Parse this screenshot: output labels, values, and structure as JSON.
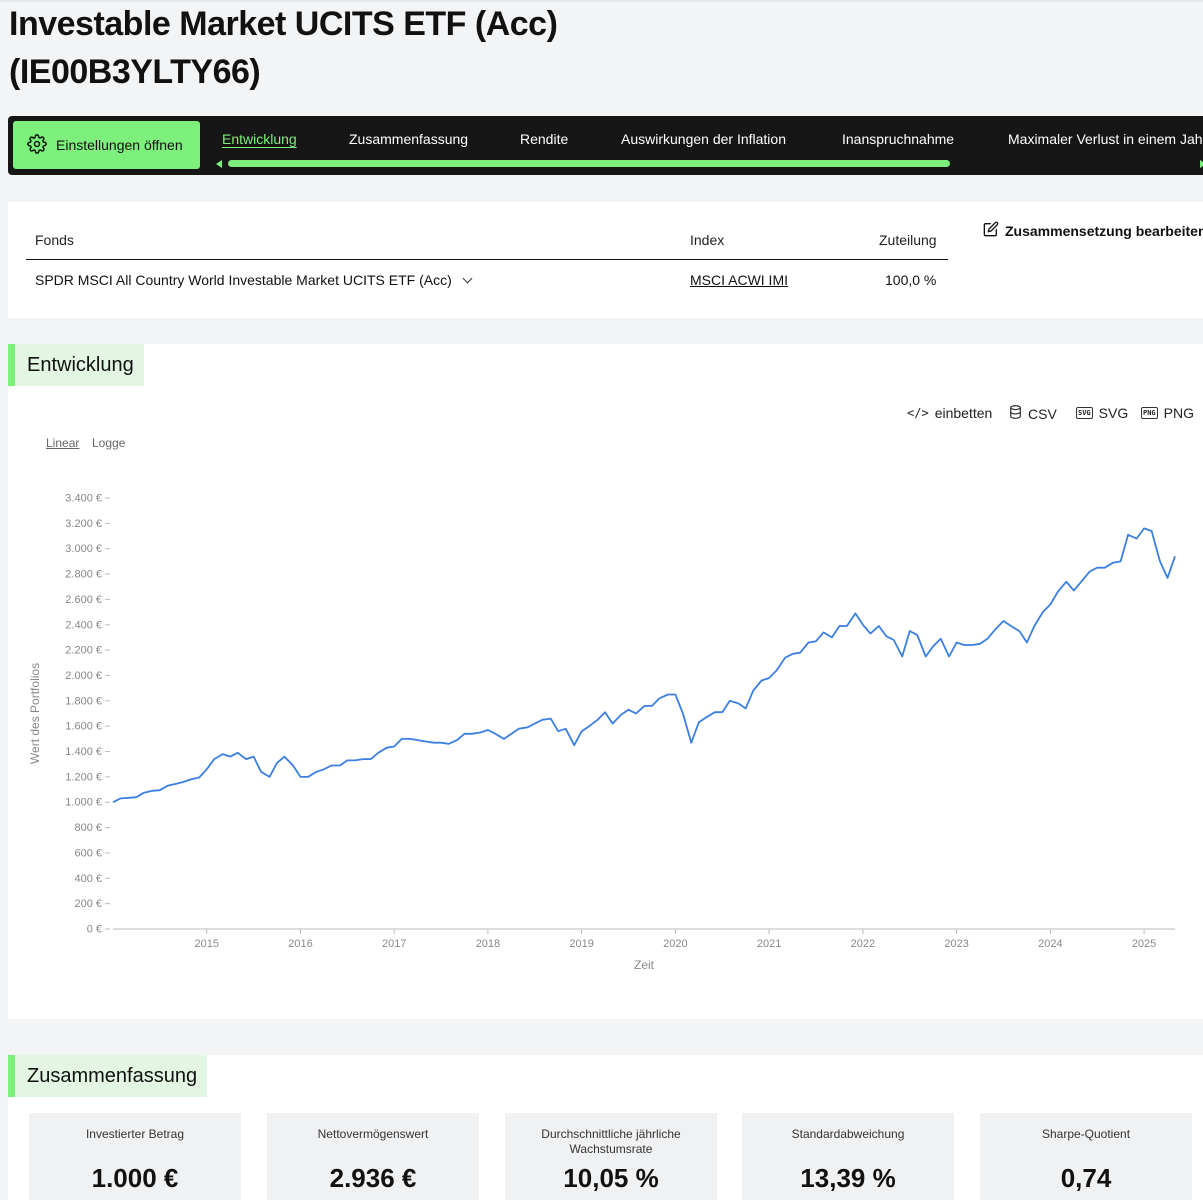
{
  "page": {
    "title_line1": "Investable Market UCITS ETF (Acc)",
    "title_line2": "(IE00B3YLTY66)"
  },
  "nav": {
    "settings_label": "Einstellungen öffnen",
    "tabs": [
      "Entwicklung",
      "Zusammenfassung",
      "Rendite",
      "Auswirkungen der Inflation",
      "Inanspruchnahme",
      "Maximaler Verlust in einem Jahr"
    ],
    "active_tab": "Entwicklung"
  },
  "fund_table": {
    "headers": {
      "fund": "Fonds",
      "index": "Index",
      "allocation": "Zuteilung"
    },
    "rows": [
      {
        "fund": "SPDR MSCI All Country World Investable Market UCITS ETF (Acc)",
        "index": "MSCI ACWI IMI",
        "allocation": "100,0 %"
      }
    ],
    "edit_label": "Zusammensetzung bearbeiten"
  },
  "development": {
    "heading": "Entwicklung",
    "exports": {
      "embed": "einbetten",
      "csv": "CSV",
      "svg": "SVG",
      "png": "PNG"
    },
    "scale_options": {
      "linear": "Linear",
      "log": "Logge"
    },
    "selected_scale": "Linear"
  },
  "chart_data": {
    "type": "line",
    "title": "",
    "xlabel": "Zeit",
    "ylabel": "Wert des Portfolios",
    "y_ticks": [
      "0 €",
      "200 €",
      "400 €",
      "600 €",
      "800 €",
      "1.000 €",
      "1.200 €",
      "1.400 €",
      "1.600 €",
      "1.800 €",
      "2.000 €",
      "2.200 €",
      "2.400 €",
      "2.600 €",
      "2.800 €",
      "3.000 €",
      "3.200 €",
      "3.400 €"
    ],
    "ylim": [
      0,
      3400
    ],
    "x_ticks": [
      "2015",
      "2016",
      "2017",
      "2018",
      "2019",
      "2020",
      "2021",
      "2022",
      "2023",
      "2024",
      "2025"
    ],
    "xlim": [
      2014.0,
      2025.33
    ],
    "grid": false,
    "color": "#3b7fe0",
    "series": [
      {
        "x": [
          2014.0,
          2014.08,
          2014.17,
          2014.25,
          2014.33,
          2014.42,
          2014.5,
          2014.58,
          2014.67,
          2014.75,
          2014.83,
          2014.92,
          2015.0,
          2015.08,
          2015.17,
          2015.25,
          2015.33,
          2015.42,
          2015.5,
          2015.58,
          2015.67,
          2015.75,
          2015.83,
          2015.92,
          2016.0,
          2016.08,
          2016.17,
          2016.25,
          2016.33,
          2016.42,
          2016.5,
          2016.58,
          2016.67,
          2016.75,
          2016.83,
          2016.92,
          2017.0,
          2017.08,
          2017.17,
          2017.25,
          2017.33,
          2017.42,
          2017.5,
          2017.58,
          2017.67,
          2017.75,
          2017.83,
          2017.92,
          2018.0,
          2018.08,
          2018.17,
          2018.25,
          2018.33,
          2018.42,
          2018.5,
          2018.58,
          2018.67,
          2018.75,
          2018.83,
          2018.92,
          2019.0,
          2019.08,
          2019.17,
          2019.25,
          2019.33,
          2019.42,
          2019.5,
          2019.58,
          2019.67,
          2019.75,
          2019.83,
          2019.92,
          2020.0,
          2020.08,
          2020.17,
          2020.25,
          2020.33,
          2020.42,
          2020.5,
          2020.58,
          2020.67,
          2020.75,
          2020.83,
          2020.92,
          2021.0,
          2021.08,
          2021.17,
          2021.25,
          2021.33,
          2021.42,
          2021.5,
          2021.58,
          2021.67,
          2021.75,
          2021.83,
          2021.92,
          2022.0,
          2022.08,
          2022.17,
          2022.25,
          2022.33,
          2022.42,
          2022.5,
          2022.58,
          2022.67,
          2022.75,
          2022.83,
          2022.92,
          2023.0,
          2023.08,
          2023.17,
          2023.25,
          2023.33,
          2023.42,
          2023.5,
          2023.58,
          2023.67,
          2023.75,
          2023.83,
          2023.92,
          2024.0,
          2024.08,
          2024.17,
          2024.25,
          2024.33,
          2024.42,
          2024.5,
          2024.58,
          2024.67,
          2024.75,
          2024.83,
          2024.92,
          2025.0,
          2025.08,
          2025.17,
          2025.25,
          2025.33
        ],
        "values": [
          1000,
          1030,
          1035,
          1040,
          1075,
          1090,
          1095,
          1130,
          1145,
          1160,
          1180,
          1195,
          1260,
          1340,
          1380,
          1360,
          1390,
          1340,
          1360,
          1240,
          1200,
          1310,
          1360,
          1290,
          1200,
          1200,
          1240,
          1260,
          1290,
          1290,
          1330,
          1330,
          1340,
          1340,
          1390,
          1430,
          1440,
          1500,
          1500,
          1490,
          1480,
          1470,
          1470,
          1460,
          1490,
          1540,
          1540,
          1550,
          1570,
          1540,
          1500,
          1540,
          1580,
          1590,
          1620,
          1650,
          1660,
          1560,
          1580,
          1450,
          1560,
          1600,
          1650,
          1710,
          1620,
          1690,
          1730,
          1700,
          1760,
          1760,
          1820,
          1850,
          1850,
          1700,
          1470,
          1630,
          1670,
          1710,
          1710,
          1800,
          1780,
          1740,
          1880,
          1960,
          1980,
          2040,
          2140,
          2170,
          2180,
          2260,
          2270,
          2340,
          2300,
          2390,
          2390,
          2490,
          2400,
          2330,
          2390,
          2310,
          2280,
          2150,
          2350,
          2320,
          2150,
          2230,
          2290,
          2150,
          2260,
          2240,
          2240,
          2250,
          2290,
          2370,
          2430,
          2390,
          2350,
          2260,
          2390,
          2500,
          2560,
          2660,
          2740,
          2670,
          2740,
          2820,
          2850,
          2850,
          2890,
          2900,
          3110,
          3080,
          3160,
          3140,
          2900,
          2770,
          2940
        ]
      }
    ]
  },
  "summary": {
    "heading": "Zusammenfassung",
    "stats": [
      {
        "label": "Investierter Betrag",
        "value": "1.000 €"
      },
      {
        "label": "Nettovermögenswert",
        "value": "2.936 €"
      },
      {
        "label": "Durchschnittliche jährliche Wachstumsrate",
        "value": "10,05 %"
      },
      {
        "label": "Standardabweichung",
        "value": "13,39 %"
      },
      {
        "label": "Sharpe-Quotient",
        "value": "0,74"
      }
    ]
  }
}
